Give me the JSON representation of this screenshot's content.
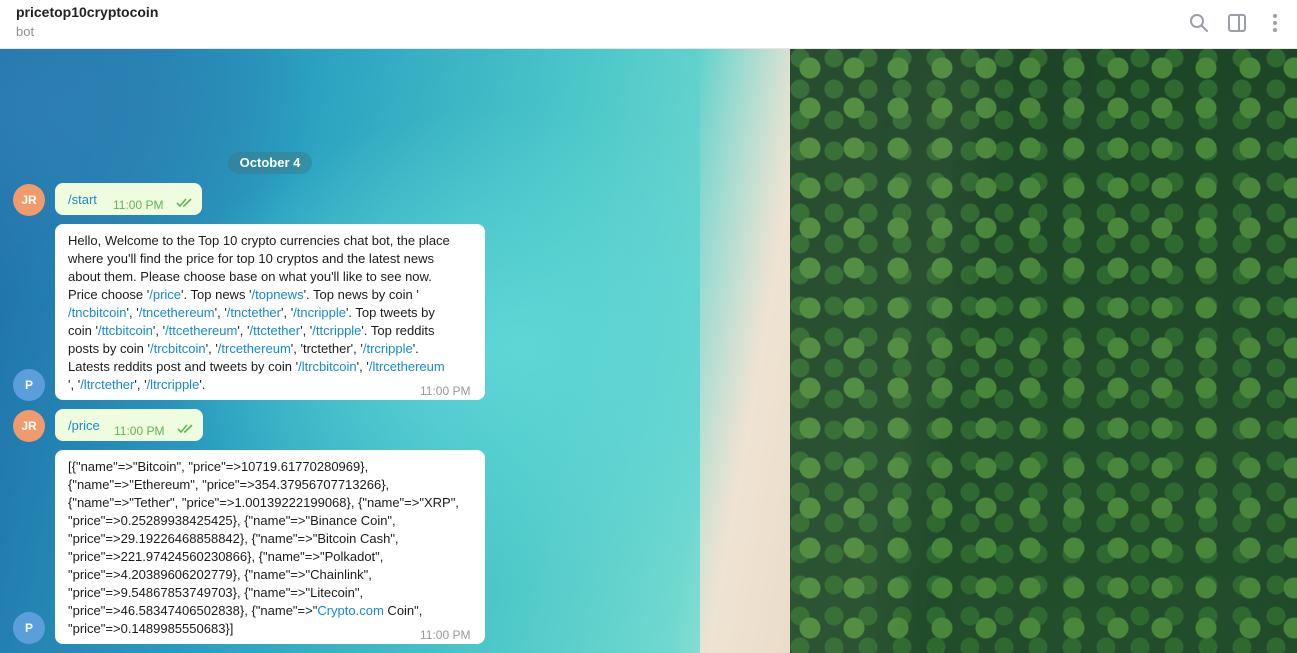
{
  "header": {
    "title": "pricetop10cryptocoin",
    "subtitle": "bot"
  },
  "icons": {
    "search": "search-icon",
    "sidebar": "sidebar-toggle-icon",
    "more": "more-vertical-icon"
  },
  "date_separator": "October 4",
  "messages": [
    {
      "avatar": "JR",
      "text": "/start",
      "time": "11:00 PM"
    },
    {
      "avatar": "P",
      "parts": [
        "Hello, Welcome to the Top 10 crypto currencies chat bot, the place",
        "where you'll find the price for top 10 cryptos and the latest news",
        "about them. Please choose base on what you'll like to see now.",
        "Price choose '",
        "/price",
        "'. Top news '",
        "/topnews",
        "'. Top news by coin '",
        "/tncbitcoin",
        "', '",
        "/tncethereum",
        "', '",
        "/tnctether",
        "', '",
        "/tncripple",
        "'. Top tweets by",
        "coin '",
        "/ttcbitcoin",
        "', '",
        "/ttcethereum",
        "', '",
        "/ttctether",
        "', '",
        "/ttcripple",
        "'. Top reddits",
        "posts by coin '",
        "/trcbitcoin",
        "', '",
        "/trcethereum",
        "', 'trctether', '",
        "/trcripple",
        "'.",
        "Latests reddits post and tweets by coin '",
        "/ltrcbitcoin",
        "', '",
        "/ltrcethereum",
        "', '",
        "/ltrctether",
        "', '",
        "/ltrcripple",
        "'."
      ],
      "time": "11:00 PM"
    },
    {
      "avatar": "JR",
      "text": "/price",
      "time": "11:00 PM"
    },
    {
      "avatar": "P",
      "lines": [
        "[{\"name\"=>\"Bitcoin\", \"price\"=>10719.61770280969},",
        "{\"name\"=>\"Ethereum\", \"price\"=>354.37956707713266},",
        "{\"name\"=>\"Tether\", \"price\"=>1.00139222199068}, {\"name\"=>\"XRP\",",
        "\"price\"=>0.25289938425425}, {\"name\"=>\"Binance Coin\",",
        "\"price\"=>29.19226468858842}, {\"name\"=>\"Bitcoin Cash\",",
        "\"price\"=>221.97424560230866}, {\"name\"=>\"Polkadot\",",
        "\"price\"=>4.20389606202779}, {\"name\"=>\"Chainlink\",",
        "\"price\"=>9.54867853749703}, {\"name\"=>\"Litecoin\",",
        "\"price\"=>46.58347406502838}, {\"name\"=>\"",
        "Crypto.com",
        " Coin\",",
        "\"price\"=>0.1489985550683}]"
      ],
      "time": "11:00 PM"
    }
  ]
}
